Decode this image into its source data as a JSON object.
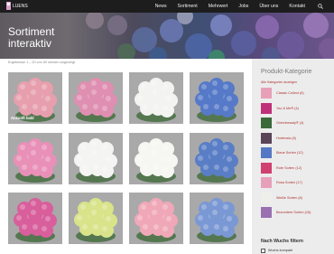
{
  "nav": {
    "logo_text": "LUENS",
    "items": [
      "News",
      "Sortiment",
      "Mehrwert",
      "Jobs",
      "Über uns",
      "Kontakt"
    ]
  },
  "hero": {
    "title_line1": "Sortiment",
    "title_line2": "interaktiv"
  },
  "breadcrumb": "Ergebnisse 1 – 20 von 69 werden angezeigt",
  "grid": {
    "tiles": [
      {
        "label": "Ankunft bald",
        "color": "#e79fae"
      },
      {
        "label": "",
        "color": "#df8fb1"
      },
      {
        "label": "",
        "color": "#f3f3f2"
      },
      {
        "label": "",
        "color": "#5679c8"
      },
      {
        "label": "",
        "color": "#e990b8"
      },
      {
        "label": "",
        "color": "#f4f4f2"
      },
      {
        "label": "",
        "color": "#f6f6f2"
      },
      {
        "label": "",
        "color": "#5a7ec6"
      },
      {
        "label": "",
        "color": "#d85f9c"
      },
      {
        "label": "",
        "color": "#d9e38a"
      },
      {
        "label": "",
        "color": "#f0a8b8"
      },
      {
        "label": "",
        "color": "#7a98d4"
      }
    ]
  },
  "sidebar": {
    "heading": "Produkt-Kategorie",
    "all_link": "Alle Kategorien anzeigen",
    "categories": [
      {
        "label": "Classic Collect (6)",
        "color": "#e8a0b8"
      },
      {
        "label": "You & Me® (4)",
        "color": "#c03078"
      },
      {
        "label": "Greenbeauty® (4)",
        "color": "#3a6a3a"
      },
      {
        "label": "Hortensia (6)",
        "color": "#5a4458"
      },
      {
        "label": "Blaue Sorten (12)",
        "color": "#5678c4"
      },
      {
        "label": "Rote Sorten (12)",
        "color": "#d04070"
      },
      {
        "label": "Rosa Sorten (17)",
        "color": "#e6a0ba"
      },
      {
        "label": "Weiße Sorten (8)",
        "color": "#eeeeea"
      },
      {
        "label": "Bezondere Sorten (16)",
        "color": "#9a70b0"
      }
    ],
    "filter_heading": "Nach Wuchs filtern",
    "filter_option": "Wuchs kompakt"
  }
}
